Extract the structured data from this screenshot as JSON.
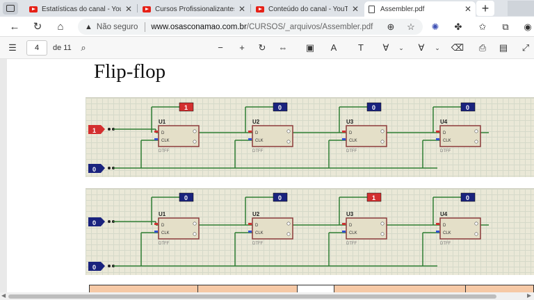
{
  "tabs": [
    {
      "label": "Estatísticas do canal - YouTube",
      "favicon": "youtube-icon",
      "active": false
    },
    {
      "label": "Cursos Profissionalizantes - YouTube",
      "favicon": "youtube-icon",
      "active": false
    },
    {
      "label": "Conteúdo do canal - YouTube",
      "favicon": "youtube-icon",
      "active": false
    },
    {
      "label": "Assembler.pdf",
      "favicon": "document-icon",
      "active": true
    }
  ],
  "address": {
    "security_label": "Não seguro",
    "url_host": "www.osasconamao.com.br",
    "url_path": "/CURSOS/_arquivos/Assembler.pdf"
  },
  "pdf_toolbar": {
    "page_current": "4",
    "page_total": "de 11"
  },
  "document": {
    "heading": "Flip-flop",
    "circuit_top": {
      "inputs": [
        "1",
        "0"
      ],
      "flipflops": [
        "U1",
        "U2",
        "U3",
        "U4"
      ],
      "outputs": [
        "1",
        "0",
        "0",
        "0"
      ],
      "pin_d": "D",
      "pin_clk": "CLK",
      "part": "DTFF"
    },
    "circuit_bottom": {
      "inputs": [
        "0",
        "0"
      ],
      "flipflops": [
        "U1",
        "U2",
        "U3",
        "U4"
      ],
      "outputs": [
        "0",
        "0",
        "1",
        "0"
      ],
      "pin_d": "D",
      "pin_clk": "CLK",
      "part": "DTFF"
    }
  },
  "colors": {
    "accent": "#0078d4",
    "probe_high": "#d32f2f",
    "probe_low": "#1a237e",
    "wire": "#2e7d32",
    "schematic_bg": "#eae8d7"
  }
}
